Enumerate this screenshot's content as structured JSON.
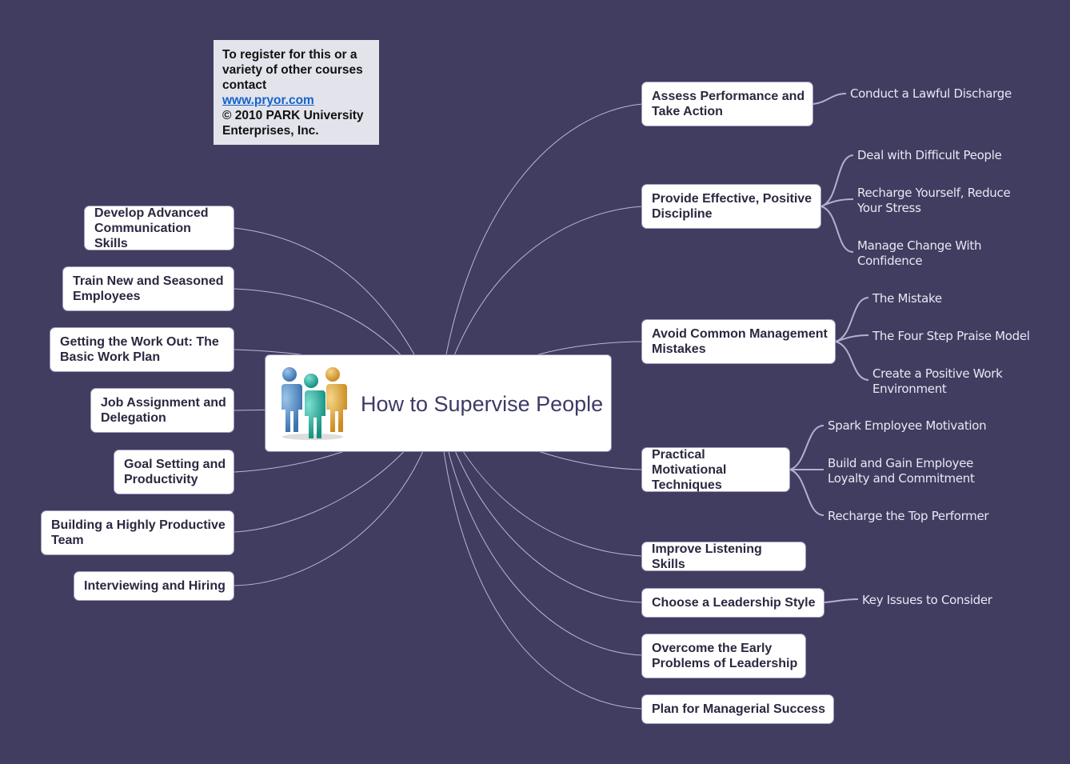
{
  "info_box": {
    "text": "To register for this or a variety of other courses contact",
    "link": "www.pryor.com",
    "copyright": "© 2010 PARK University Enterprises, Inc."
  },
  "central": {
    "title": "How to Supervise People",
    "icon": "people-group-icon"
  },
  "colors": {
    "background": "#403d60",
    "node_fill": "#ffffff",
    "connector": "#b9b6d4",
    "link": "#1463c8",
    "person_blue": "#4a86c0",
    "person_teal": "#1ea89a",
    "person_gold": "#e0a232"
  },
  "left_topics": [
    {
      "label": "Develop Advanced\nCommunication Skills"
    },
    {
      "label": "Train New and Seasoned\nEmployees"
    },
    {
      "label": "Getting the Work Out: The\nBasic Work Plan"
    },
    {
      "label": "Job Assignment and\nDelegation"
    },
    {
      "label": "Goal Setting and\nProductivity"
    },
    {
      "label": "Building a Highly Productive\nTeam"
    },
    {
      "label": "Interviewing and Hiring"
    }
  ],
  "right_topics": [
    {
      "label": "Assess Performance and\nTake Action",
      "subtopics": [
        "Conduct a Lawful Discharge"
      ]
    },
    {
      "label": "Provide Effective, Positive\nDiscipline",
      "subtopics": [
        "Deal with Difficult People",
        "Recharge Yourself, Reduce\nYour Stress",
        "Manage Change With\nConfidence"
      ]
    },
    {
      "label": "Avoid Common Management\nMistakes",
      "subtopics": [
        "The Mistake",
        "The Four Step Praise Model",
        "Create a Positive Work\nEnvironment"
      ]
    },
    {
      "label": "Practical Motivational\nTechniques",
      "subtopics": [
        "Spark Employee Motivation",
        "Build and Gain Employee\nLoyalty and Commitment",
        "Recharge the Top Performer"
      ]
    },
    {
      "label": "Improve Listening Skills",
      "subtopics": []
    },
    {
      "label": "Choose a Leadership Style",
      "subtopics": [
        "Key Issues to Consider"
      ]
    },
    {
      "label": "Overcome the Early\nProblems of Leadership",
      "subtopics": []
    },
    {
      "label": "Plan for Managerial Success",
      "subtopics": []
    }
  ]
}
